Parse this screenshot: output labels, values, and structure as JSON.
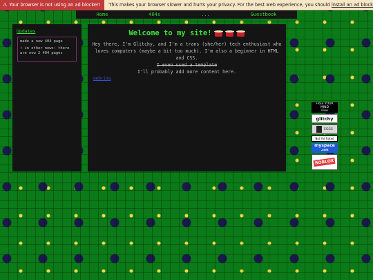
{
  "banner": {
    "warning_icon": "warning-icon",
    "warning": "Your browser is not using an ad blocker!",
    "message": "This makes your browser slower and hurts your privacy. For the best web experience, you should ",
    "link": "install an ad blocker",
    "link_tail": ".",
    "close": "✕"
  },
  "nav": {
    "items": [
      "Home",
      "404s",
      "...",
      "Guestbook"
    ]
  },
  "sidebar": {
    "heading": "Updates",
    "updates": [
      "made a new 404 page",
      "• in other news: there are now 2 404 pages"
    ]
  },
  "main": {
    "title": "Welcome to my site!",
    "intro": "Hey there, I'm Glitchy, and I'm a trans (she/her) tech enthusiast who loves computers (maybe a bit too much). I'm also a beginner in HTML and CSS.",
    "struck": "I even used a template",
    "outro": "I'll probably add more content here.",
    "link": "webring"
  },
  "buttons": {
    "b1_top": "FREE YOUR MIND",
    "b1_bottom": "Free",
    "b2": "glitchy",
    "b3": "EGGS",
    "b4": "Not Yet Rated",
    "b5_top": "myspace",
    "b5_bottom": ".com",
    "b6": "ROBLOX"
  }
}
